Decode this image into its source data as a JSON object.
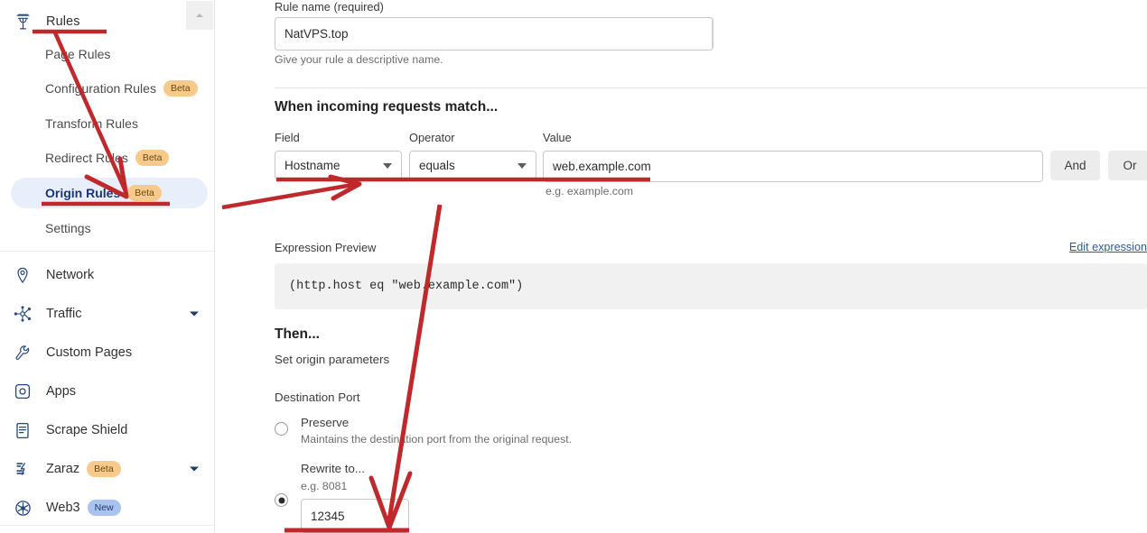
{
  "sidebar": {
    "header": {
      "label": "Rules",
      "icon": "funnel-icon"
    },
    "sub_items": [
      {
        "label": "Page Rules",
        "badge": ""
      },
      {
        "label": "Configuration Rules",
        "badge": "Beta"
      },
      {
        "label": "Transform Rules",
        "badge": ""
      },
      {
        "label": "Redirect Rules",
        "badge": "Beta"
      },
      {
        "label": "Origin Rules",
        "badge": "Beta",
        "active": true
      },
      {
        "label": "Settings",
        "badge": ""
      }
    ],
    "main_items": [
      {
        "label": "Network",
        "icon": "location-pin-icon",
        "caret": false,
        "badge": ""
      },
      {
        "label": "Traffic",
        "icon": "share-nodes-icon",
        "caret": true,
        "badge": ""
      },
      {
        "label": "Custom Pages",
        "icon": "wrench-icon",
        "caret": false,
        "badge": ""
      },
      {
        "label": "Apps",
        "icon": "app-square-icon",
        "caret": false,
        "badge": ""
      },
      {
        "label": "Scrape Shield",
        "icon": "document-icon",
        "caret": false,
        "badge": ""
      },
      {
        "label": "Zaraz",
        "icon": "zaraz-icon",
        "caret": true,
        "badge": "Beta"
      },
      {
        "label": "Web3",
        "icon": "web3-icon",
        "caret": false,
        "badge": "New"
      }
    ],
    "scroll_up_button": "scrollbar-up-arrow"
  },
  "main": {
    "rule_name": {
      "label": "Rule name (required)",
      "value": "NatVPS.top",
      "helper": "Give your rule a descriptive name."
    },
    "match_section": {
      "title": "When incoming requests match...",
      "field": {
        "label": "Field",
        "value": "Hostname"
      },
      "operator": {
        "label": "Operator",
        "value": "equals"
      },
      "value": {
        "label": "Value",
        "value": "web.example.com",
        "helper": "e.g. example.com"
      },
      "and_button": "And",
      "or_button": "Or"
    },
    "expression": {
      "label": "Expression Preview",
      "edit_link": "Edit expression",
      "code": "(http.host eq \"web.example.com\")"
    },
    "then_section": {
      "title": "Then...",
      "subtitle": "Set origin parameters",
      "destination_port_label": "Destination Port",
      "preserve": {
        "label": "Preserve",
        "description": "Maintains the destination port from the original request.",
        "selected": false
      },
      "rewrite": {
        "label": "Rewrite to...",
        "helper": "e.g. 8081",
        "value": "12345",
        "selected": true
      }
    }
  },
  "annotations": {
    "color": "#c0292b",
    "underline_rules": "underline-rules-nav",
    "underline_origin_rules": "underline-origin-rules-nav",
    "arrow_to_origin_rules": "arrow-pointing-origin-rules",
    "underline_match_row": "underline-field-operator-value",
    "arrow_to_match_row": "arrow-pointing-match-row",
    "arrow_to_port": "arrow-pointing-destination-port",
    "underline_port": "underline-port-input"
  }
}
